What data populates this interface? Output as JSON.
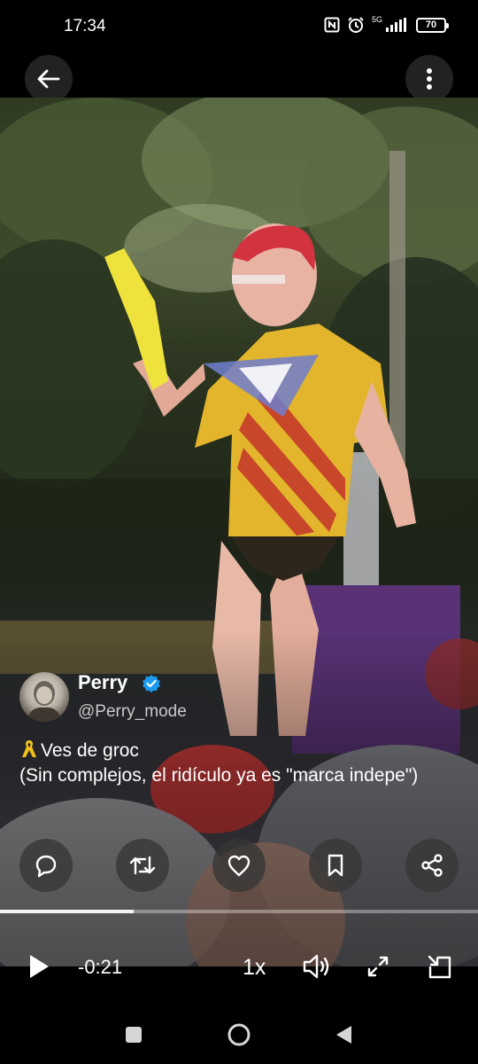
{
  "status_bar": {
    "time": "17:34",
    "network": "5G",
    "battery": "70"
  },
  "top_bar": {
    "back_icon": "arrow-left-icon",
    "menu_icon": "more-vertical-icon"
  },
  "tweet": {
    "author_name": "Perry",
    "author_handle": "@Perry_mode",
    "verified": true,
    "text_line1": "Ves de groc",
    "text_line2": "(Sin complejos, el ridículo ya es \"marca indepe\")"
  },
  "actions": [
    "reply-icon",
    "retweet-icon",
    "like-icon",
    "bookmark-icon",
    "share-icon"
  ],
  "player": {
    "progress": 0.28,
    "time_remaining": "-0:21",
    "speed": "1x"
  },
  "colors": {
    "verified": "#1d9bf0",
    "ribbon": "#f2c21b"
  }
}
